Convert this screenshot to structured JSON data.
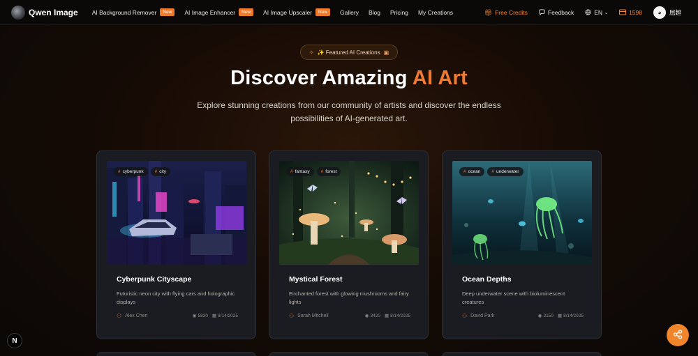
{
  "nav": {
    "brand": "Qwen Image",
    "links": [
      {
        "label": "AI Background Remover",
        "badge": "New"
      },
      {
        "label": "AI Image Enhancer",
        "badge": "New"
      },
      {
        "label": "AI Image Upscaler",
        "badge": "New"
      },
      {
        "label": "Gallery"
      },
      {
        "label": "Blog"
      },
      {
        "label": "Pricing"
      },
      {
        "label": "My Creations"
      }
    ],
    "free_credits": "Free Credits",
    "feedback": "Feedback",
    "language": "EN",
    "credits": "1598",
    "user_name": "屈超"
  },
  "hero": {
    "pill": "✨ Featured AI Creations",
    "title_main": "Discover Amazing ",
    "title_accent": "AI Art",
    "subtitle": "Explore stunning creations from our community of artists and discover the endless possibilities of AI-generated art."
  },
  "cards": [
    {
      "title": "Cyberpunk Cityscape",
      "description": "Futuristic neon city with flying cars and holographic displays",
      "author": "Alex Chen",
      "views": "5830",
      "date": "8/14/2025",
      "tags": [
        "cyberpunk",
        "city"
      ]
    },
    {
      "title": "Mystical Forest",
      "description": "Enchanted forest with glowing mushrooms and fairy lights",
      "author": "Sarah Mitchell",
      "views": "3420",
      "date": "8/14/2025",
      "tags": [
        "fantasy",
        "forest"
      ]
    },
    {
      "title": "Ocean Depths",
      "description": "Deep underwater scene with bioluminescent creatures",
      "author": "David Park",
      "views": "2150",
      "date": "8/14/2025",
      "tags": [
        "ocean",
        "underwater"
      ]
    }
  ],
  "floating": {
    "n_badge": "N"
  },
  "colors": {
    "accent": "#f07a34",
    "card_bg": "#1a1c21",
    "nav_bg": "#0b0908"
  }
}
